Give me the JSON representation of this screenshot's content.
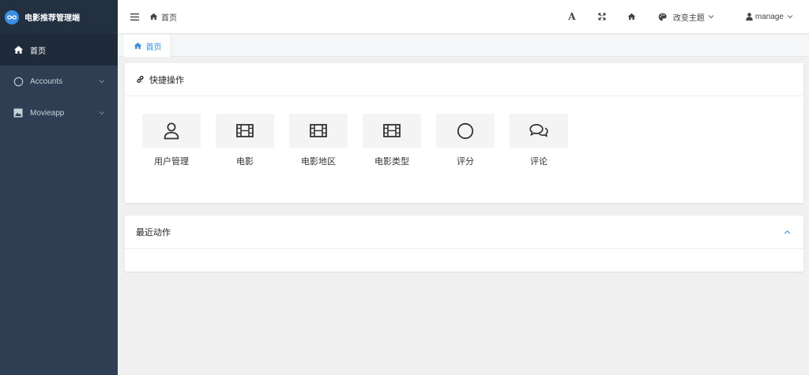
{
  "brand": {
    "title": "电影推荐管理端",
    "logo_icon": "infinity-icon",
    "logo_color": "#3a8ee6"
  },
  "sidebar": {
    "items": [
      {
        "label": "首页",
        "icon": "home-icon",
        "active": true
      },
      {
        "label": "Accounts",
        "icon": "circle-icon",
        "expandable": true
      },
      {
        "label": "Movieapp",
        "icon": "image-icon",
        "expandable": true
      }
    ],
    "bg_color": "#2f3e52",
    "active_color": "#1f2b3a"
  },
  "header": {
    "breadcrumb": "首页",
    "font_glyph": "A",
    "theme_label": "改变主题",
    "user_label": "manage"
  },
  "tabs": [
    {
      "label": "首页",
      "icon": "home-icon",
      "active": true
    }
  ],
  "quick_actions": {
    "title": "快捷操作",
    "items": [
      {
        "label": "用户管理",
        "icon": "user-icon"
      },
      {
        "label": "电影",
        "icon": "film-icon"
      },
      {
        "label": "电影地区",
        "icon": "film-icon"
      },
      {
        "label": "电影类型",
        "icon": "film-icon"
      },
      {
        "label": "评分",
        "icon": "circle-icon"
      },
      {
        "label": "评论",
        "icon": "comments-icon"
      }
    ]
  },
  "recent": {
    "title": "最近动作"
  },
  "colors": {
    "accent": "#3a8ee6"
  }
}
